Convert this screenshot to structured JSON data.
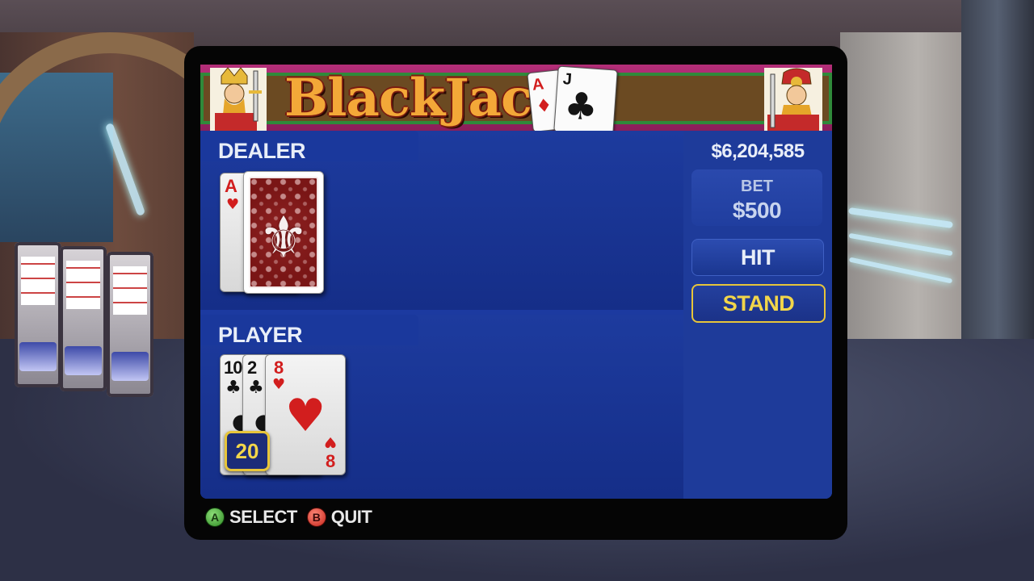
{
  "banner": {
    "title": "BlackJack",
    "mini_cards": [
      {
        "rank": "A",
        "suit": "♦",
        "color": "#d21e1e"
      },
      {
        "rank": "J",
        "suit": "♣",
        "color": "#141414"
      }
    ]
  },
  "dealer": {
    "label": "DEALER",
    "cards": [
      {
        "rank": "A",
        "suit": "♥",
        "color": "#d21e1e",
        "face_up": true
      },
      {
        "face_up": false
      }
    ]
  },
  "player": {
    "label": "PLAYER",
    "cards": [
      {
        "rank": "10",
        "suit": "♣",
        "color": "#141414"
      },
      {
        "rank": "2",
        "suit": "♣",
        "color": "#141414"
      },
      {
        "rank": "8",
        "suit": "♥",
        "color": "#d21e1e"
      }
    ],
    "total": "20"
  },
  "side": {
    "money": "$6,204,585",
    "bet_label": "BET",
    "bet_value": "$500",
    "hit_label": "HIT",
    "stand_label": "STAND",
    "selected": "stand"
  },
  "footer": {
    "select_button": "A",
    "select_label": "SELECT",
    "quit_button": "B",
    "quit_label": "QUIT"
  },
  "colors": {
    "table_blue": "#1c3aa0",
    "highlight_yellow": "#e7c53a",
    "card_red": "#d21e1e"
  }
}
